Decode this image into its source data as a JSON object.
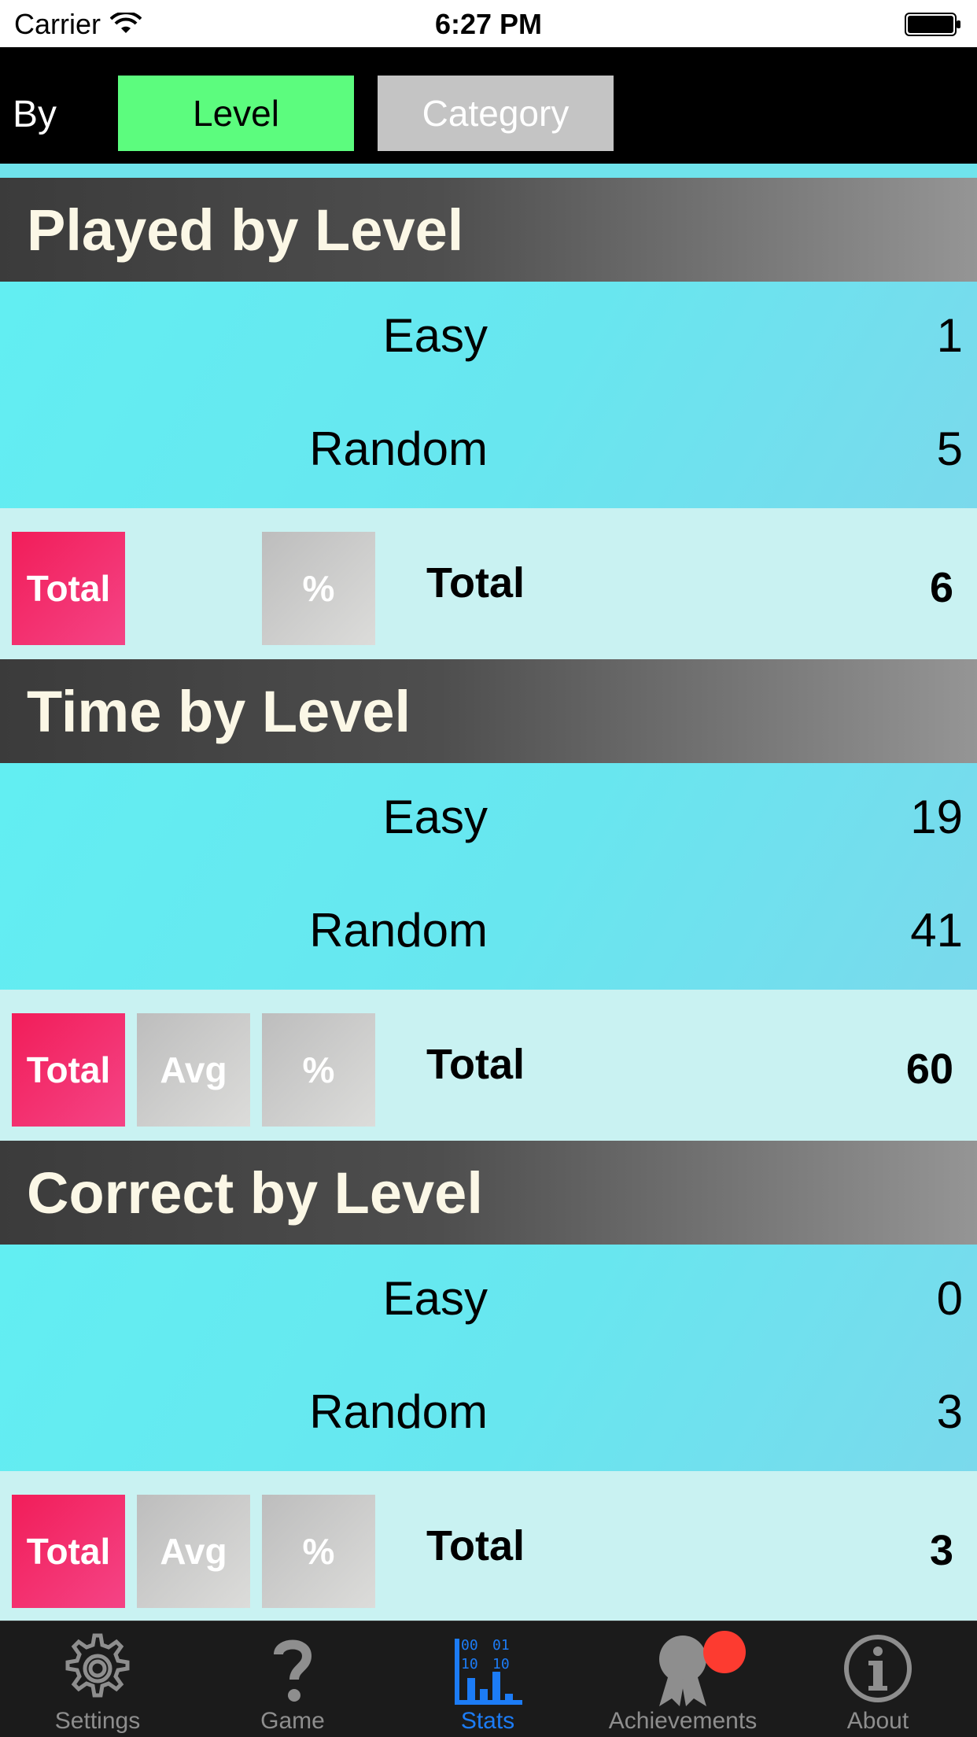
{
  "status_bar": {
    "carrier": "Carrier",
    "time": "6:27 PM"
  },
  "segment": {
    "by_label": "By",
    "options": [
      "Level",
      "Category"
    ],
    "selected": "Level"
  },
  "sections": [
    {
      "title": "Played by Level",
      "rows": [
        {
          "label": "Easy",
          "value": "1"
        },
        {
          "label": "Random",
          "value": "5"
        }
      ],
      "buttons": {
        "total": "Total",
        "avg": "",
        "percent": "%"
      },
      "footer": {
        "label": "Total",
        "value": "6"
      }
    },
    {
      "title": "Time by Level",
      "rows": [
        {
          "label": "Easy",
          "value": "19"
        },
        {
          "label": "Random",
          "value": "41"
        }
      ],
      "buttons": {
        "total": "Total",
        "avg": "Avg",
        "percent": "%"
      },
      "footer": {
        "label": "Total",
        "value": "60"
      }
    },
    {
      "title": "Correct by Level",
      "rows": [
        {
          "label": "Easy",
          "value": "0"
        },
        {
          "label": "Random",
          "value": "3"
        }
      ],
      "buttons": {
        "total": "Total",
        "avg": "Avg",
        "percent": "%"
      },
      "footer": {
        "label": "Total",
        "value": "3"
      }
    }
  ],
  "tab_bar": {
    "items": [
      {
        "label": "Settings",
        "icon": "gear-icon"
      },
      {
        "label": "Game",
        "icon": "question-mark-icon"
      },
      {
        "label": "Stats",
        "icon": "stats-chart-icon",
        "active": true
      },
      {
        "label": "Achievements",
        "icon": "ribbon-icon",
        "badge": true
      },
      {
        "label": "About",
        "icon": "info-icon"
      }
    ]
  },
  "colors": {
    "segment_selected": "#5cfc7e",
    "segment_unselected": "#c4c4c4",
    "total_button": "#f21d59",
    "tab_active": "#1c7cf6",
    "badge": "#fd3b30"
  }
}
